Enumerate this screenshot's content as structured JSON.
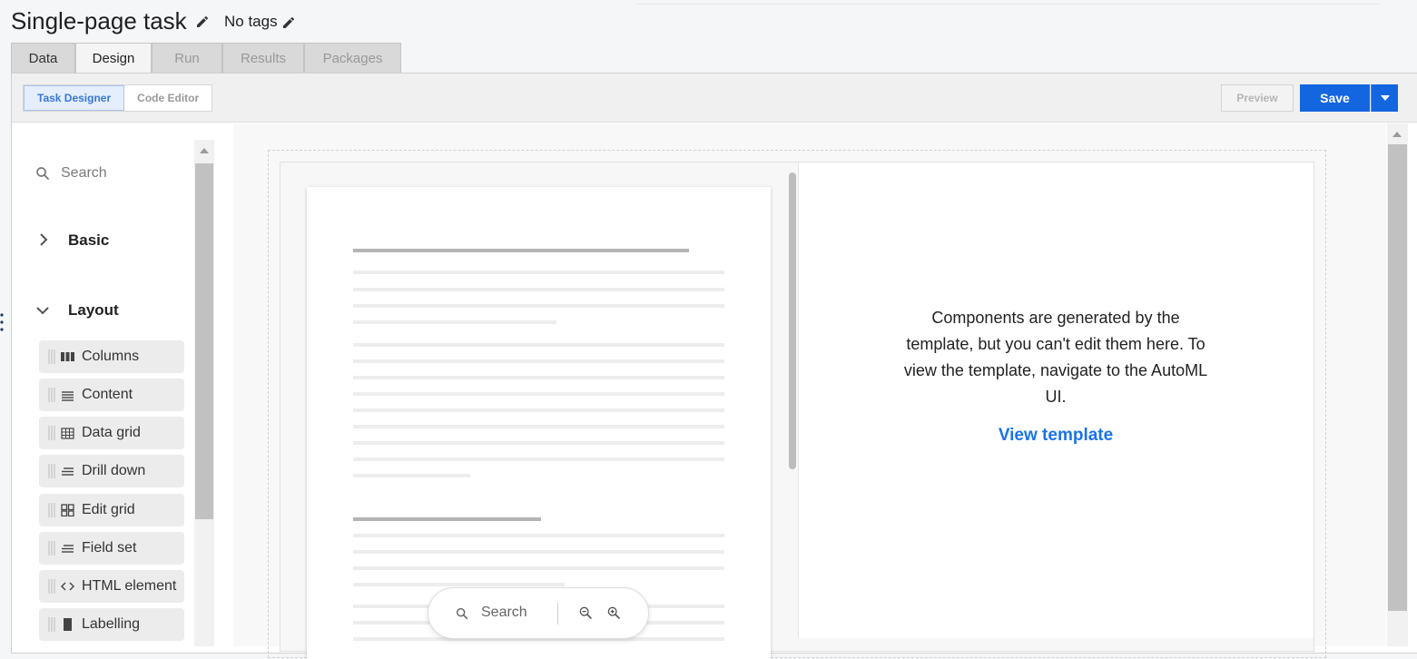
{
  "header": {
    "title": "Single-page task",
    "tags": "No tags"
  },
  "tabs": [
    {
      "label": "Data",
      "state": "normal"
    },
    {
      "label": "Design",
      "state": "active"
    },
    {
      "label": "Run",
      "state": "disabled"
    },
    {
      "label": "Results",
      "state": "disabled"
    },
    {
      "label": "Packages",
      "state": "disabled"
    }
  ],
  "toolbar": {
    "modes": [
      {
        "label": "Task Designer",
        "active": true
      },
      {
        "label": "Code Editor",
        "active": false
      }
    ],
    "preview_label": "Preview",
    "save_label": "Save"
  },
  "sidebar": {
    "search_placeholder": "Search",
    "categories": [
      {
        "label": "Basic",
        "expanded": false
      },
      {
        "label": "Layout",
        "expanded": true
      }
    ],
    "components": [
      {
        "label": "Columns",
        "icon": "columns-icon"
      },
      {
        "label": "Content",
        "icon": "content-icon"
      },
      {
        "label": "Data grid",
        "icon": "data-grid-icon"
      },
      {
        "label": "Drill down",
        "icon": "drill-down-icon"
      },
      {
        "label": "Edit grid",
        "icon": "edit-grid-icon"
      },
      {
        "label": "Field set",
        "icon": "field-set-icon"
      },
      {
        "label": "HTML element",
        "icon": "code-icon"
      },
      {
        "label": "Labelling",
        "icon": "labelling-icon"
      }
    ]
  },
  "canvas": {
    "message": "Components are generated by the template, but you can't edit them here. To view the template, navigate to the AutoML UI.",
    "view_template_label": "View template",
    "doc_search_placeholder": "Search"
  },
  "colors": {
    "accent": "#1366e0",
    "link": "#1a73e8",
    "active_mode_bg": "#e4eefc"
  }
}
